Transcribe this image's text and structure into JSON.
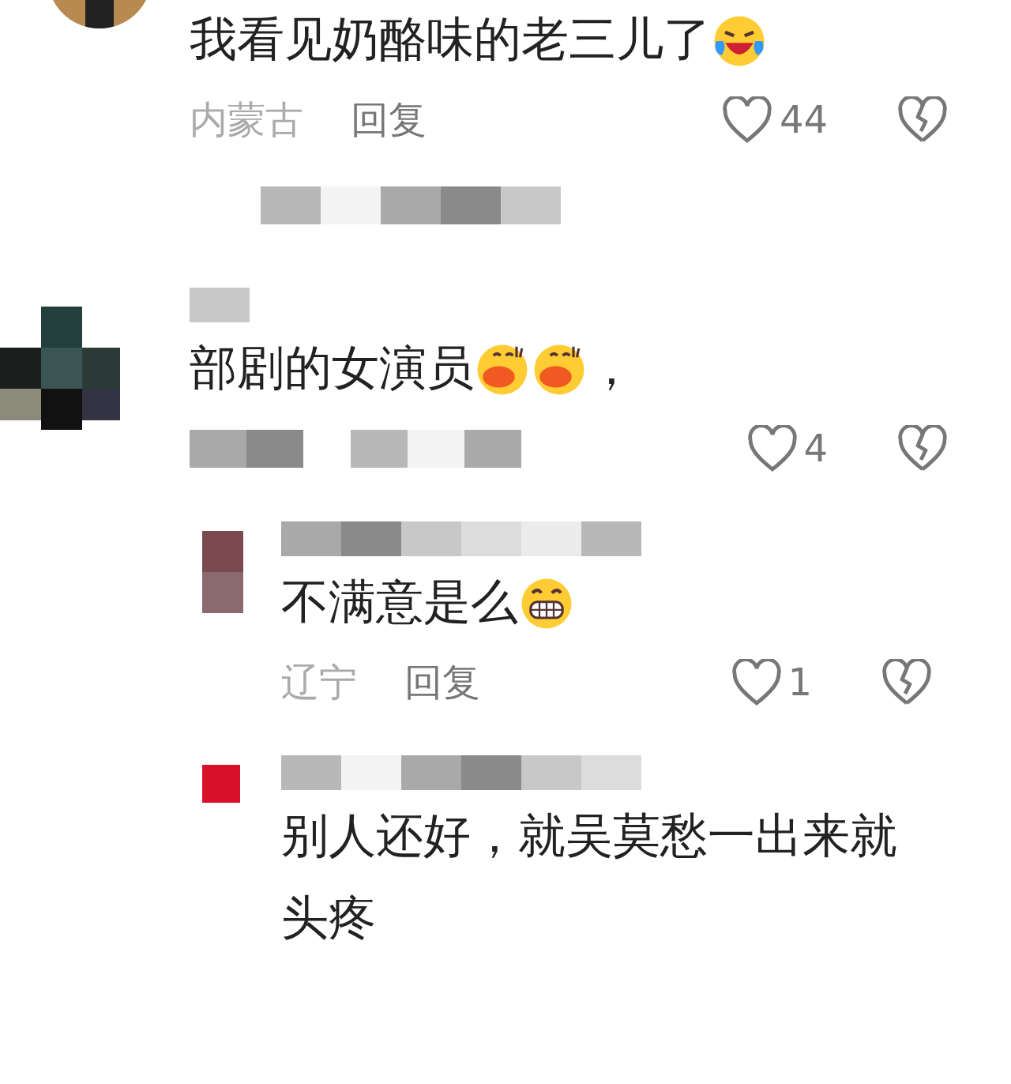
{
  "comments": [
    {
      "kind": "comment",
      "avatar": {
        "kind": "photo"
      },
      "parts": [
        {
          "kind": "text",
          "text": "我看见奶酪味的老三儿了"
        },
        {
          "kind": "tears"
        }
      ],
      "location": "内蒙古",
      "reply": "回复",
      "likes": "44",
      "replies_hidden": true
    },
    {
      "kind": "comment",
      "avatar": {
        "kind": "mosaic"
      },
      "parts": [
        {
          "kind": "text",
          "text": "部剧的女演员"
        },
        {
          "kind": "kiss"
        },
        {
          "kind": "kiss"
        },
        {
          "kind": "text",
          "text": "，"
        }
      ],
      "likes": "4"
    },
    {
      "kind": "reply",
      "avatar": {
        "kind": "mosaic"
      },
      "color": "#7a4a50",
      "parts": [
        {
          "kind": "text",
          "text": "不满意是么"
        },
        {
          "kind": "grin"
        }
      ],
      "location": "辽宁",
      "reply": "回复",
      "likes": "1"
    },
    {
      "kind": "reply",
      "avatar": {
        "kind": "square"
      },
      "color": "#d8102a",
      "parts": [
        {
          "kind": "text",
          "text": "别人还好，就吴莫愁一出来就头疼"
        }
      ]
    }
  ]
}
